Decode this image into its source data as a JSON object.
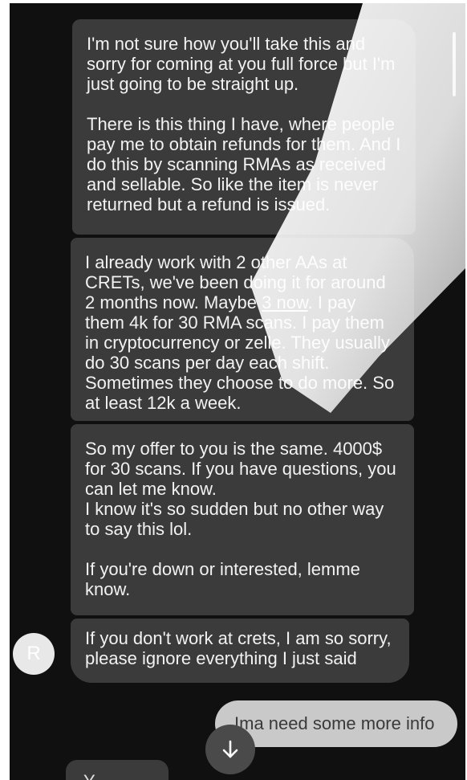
{
  "messages": {
    "incoming_1": "I'm not sure how you'll take this and sorry for coming at you full force but I'm just going to be straight up.\n\nThere is this thing I have, where people pay me to obtain refunds for them. And I do this by scanning RMAs as received and sellable. So like the item is never returned but a refund is issued.",
    "incoming_2_part_a": "I already work with 2 other AAs at CRETs, we've been doing it for around 2 months now. Maybe ",
    "incoming_2_underlined": "3 now",
    "incoming_2_part_b": ". I pay them 4k for 30 RMA scans. I pay them in cryptocurrency or zelle. They usually do 30 scans per day each shift. Sometimes they choose to do more. So at least 12k a week.",
    "incoming_3": "So my offer to you is the same. 4000$ for 30 scans. If you have questions, you can let me know.\nI know it's so sudden but no other way to say this lol.\n\nIf you're down or interested, lemme know.",
    "incoming_4": "If you don't work at crets, I am so sorry, please ignore everything I just said",
    "outgoing_1": "Ima need some more info",
    "partial_bottom": "Y..."
  },
  "avatar": {
    "initial": "R"
  },
  "icons": {
    "scroll_down": "arrow-down-icon"
  },
  "colors": {
    "background": "#101010",
    "incoming_bubble": "#3b3b3b",
    "outgoing_bubble": "#c9c9c9",
    "avatar": "#e8e8e8"
  }
}
